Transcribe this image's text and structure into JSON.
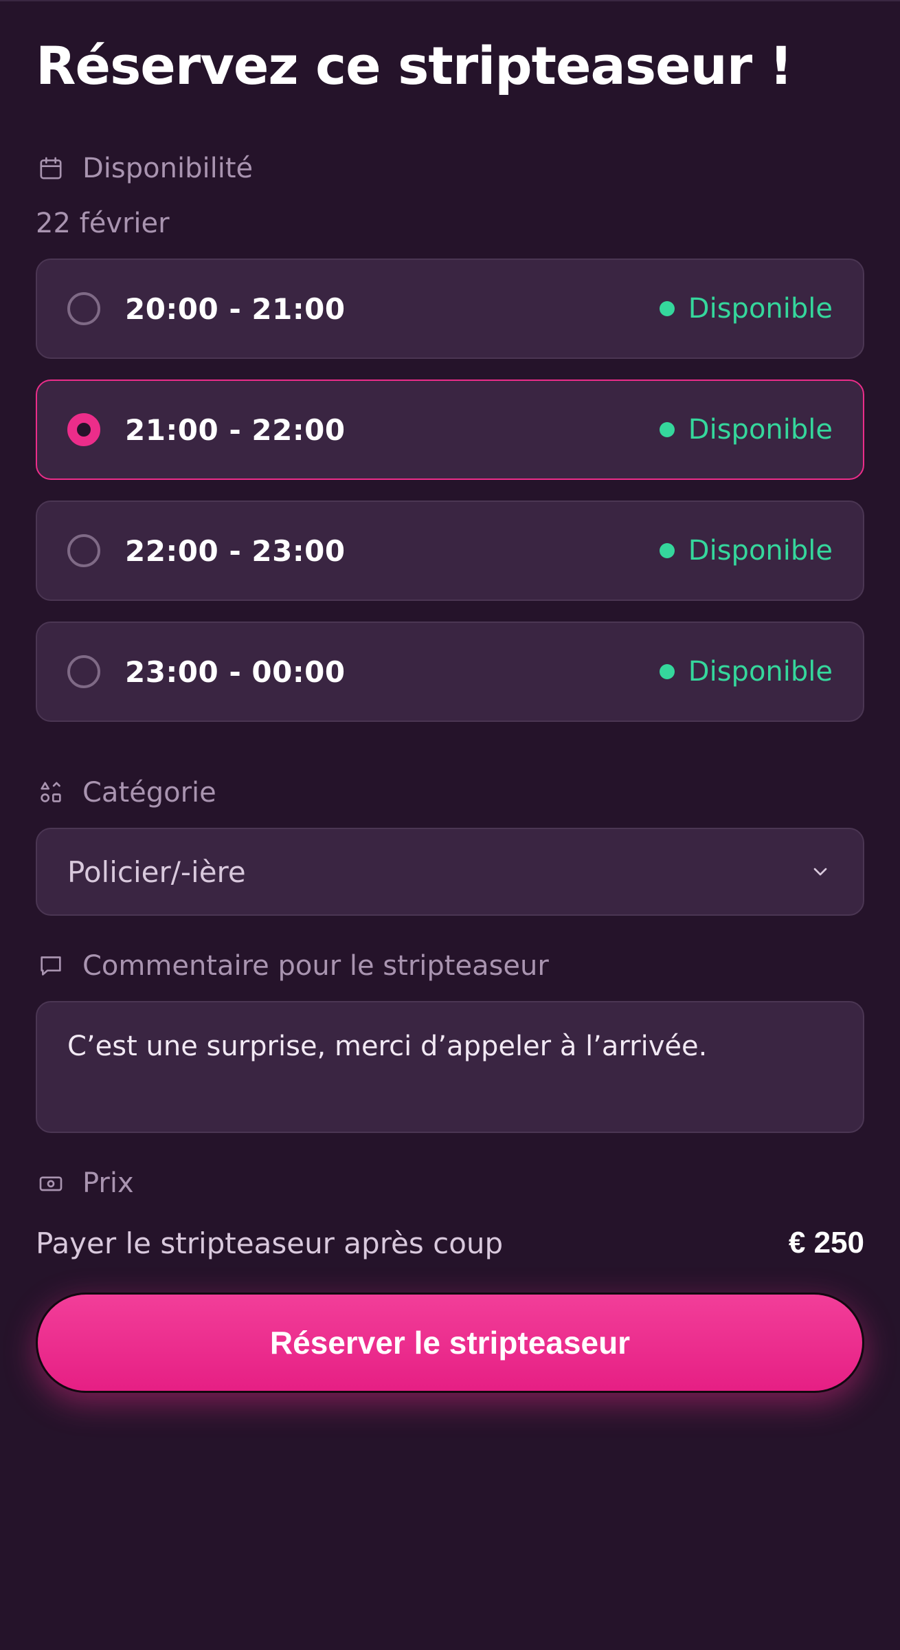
{
  "title": "Réservez ce stripteaseur !",
  "availability": {
    "label": "Disponibilité",
    "icon": "calendar-icon",
    "date": "22 février",
    "slots": [
      {
        "time": "20:00 - 21:00",
        "status": "Disponible",
        "selected": false
      },
      {
        "time": "21:00 - 22:00",
        "status": "Disponible",
        "selected": true
      },
      {
        "time": "22:00 - 23:00",
        "status": "Disponible",
        "selected": false
      },
      {
        "time": "23:00 - 00:00",
        "status": "Disponible",
        "selected": false
      }
    ]
  },
  "category": {
    "label": "Catégorie",
    "icon": "category-icon",
    "value": "Policier/-ière"
  },
  "comment": {
    "label": "Commentaire pour le stripteaseur",
    "icon": "comment-icon",
    "value": "C’est une surprise, merci d’appeler à l’arrivée."
  },
  "price": {
    "label": "Prix",
    "icon": "cash-icon",
    "description": "Payer le stripteaseur après coup",
    "amount": "€ 250"
  },
  "cta": {
    "label": "Réserver le stripteaseur"
  },
  "colors": {
    "background": "#25132a",
    "card": "#3a2542",
    "accent": "#ec2d8a",
    "available": "#35d79c",
    "muted": "#a994b0"
  }
}
